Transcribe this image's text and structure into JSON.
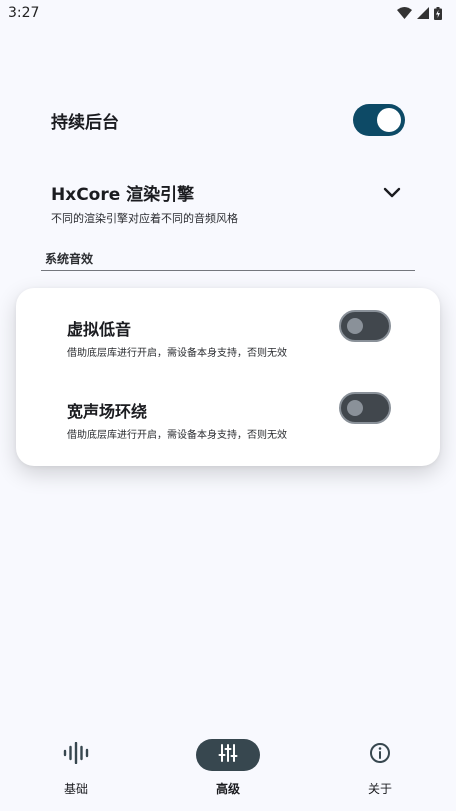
{
  "status_bar": {
    "time": "3:27"
  },
  "settings": {
    "keep_background": {
      "label": "持续后台",
      "enabled": true
    },
    "engine": {
      "label": "HxCore 渲染引擎",
      "description": "不同的渲染引擎对应着不同的音频风格"
    },
    "section_title": "系统音效",
    "card_items": [
      {
        "label": "虚拟低音",
        "description": "借助底层库进行开启，需设备本身支持，否则无效",
        "enabled": false
      },
      {
        "label": "宽声场环绕",
        "description": "借助底层库进行开启，需设备本身支持，否则无效",
        "enabled": false
      }
    ]
  },
  "nav": {
    "items": [
      {
        "label": "基础",
        "icon": "waveform-icon",
        "active": false
      },
      {
        "label": "高级",
        "icon": "tune-icon",
        "active": true
      },
      {
        "label": "关于",
        "icon": "info-icon",
        "active": false
      }
    ]
  },
  "colors": {
    "accent": "#0d4a66",
    "background": "#f8f9fe",
    "nav_active": "#37474f"
  }
}
